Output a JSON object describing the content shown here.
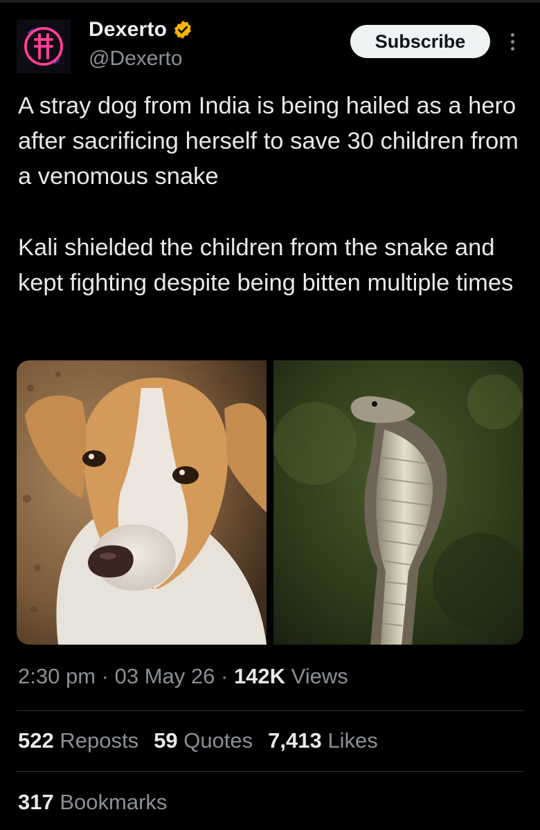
{
  "account": {
    "name": "Dexerto",
    "handle": "@Dexerto",
    "verified_icon": "verified-badge-icon",
    "verified_color": "#f5b400"
  },
  "actions": {
    "subscribe_label": "Subscribe",
    "more_icon": "more-options-icon"
  },
  "tweet": {
    "paragraph_1": "A stray dog from India is being hailed as a hero after sacrificing herself to save 30 children from a venomous snake",
    "paragraph_2": "Kali shielded the children from the snake and kept fighting despite being bitten multiple times"
  },
  "media": [
    {
      "subject": "dog-photo"
    },
    {
      "subject": "cobra-photo"
    }
  ],
  "meta": {
    "time": "2:30 pm",
    "date": "03 May 26",
    "views_count": "142K",
    "views_label": "Views",
    "separator": "·"
  },
  "stats": {
    "reposts_count": "522",
    "reposts_label": "Reposts",
    "quotes_count": "59",
    "quotes_label": "Quotes",
    "likes_count": "7,413",
    "likes_label": "Likes",
    "bookmarks_count": "317",
    "bookmarks_label": "Bookmarks"
  },
  "colors": {
    "background": "#000000",
    "text": "#e7e9ea",
    "secondary_text": "#8b9096",
    "button_bg": "#eff3f4"
  }
}
